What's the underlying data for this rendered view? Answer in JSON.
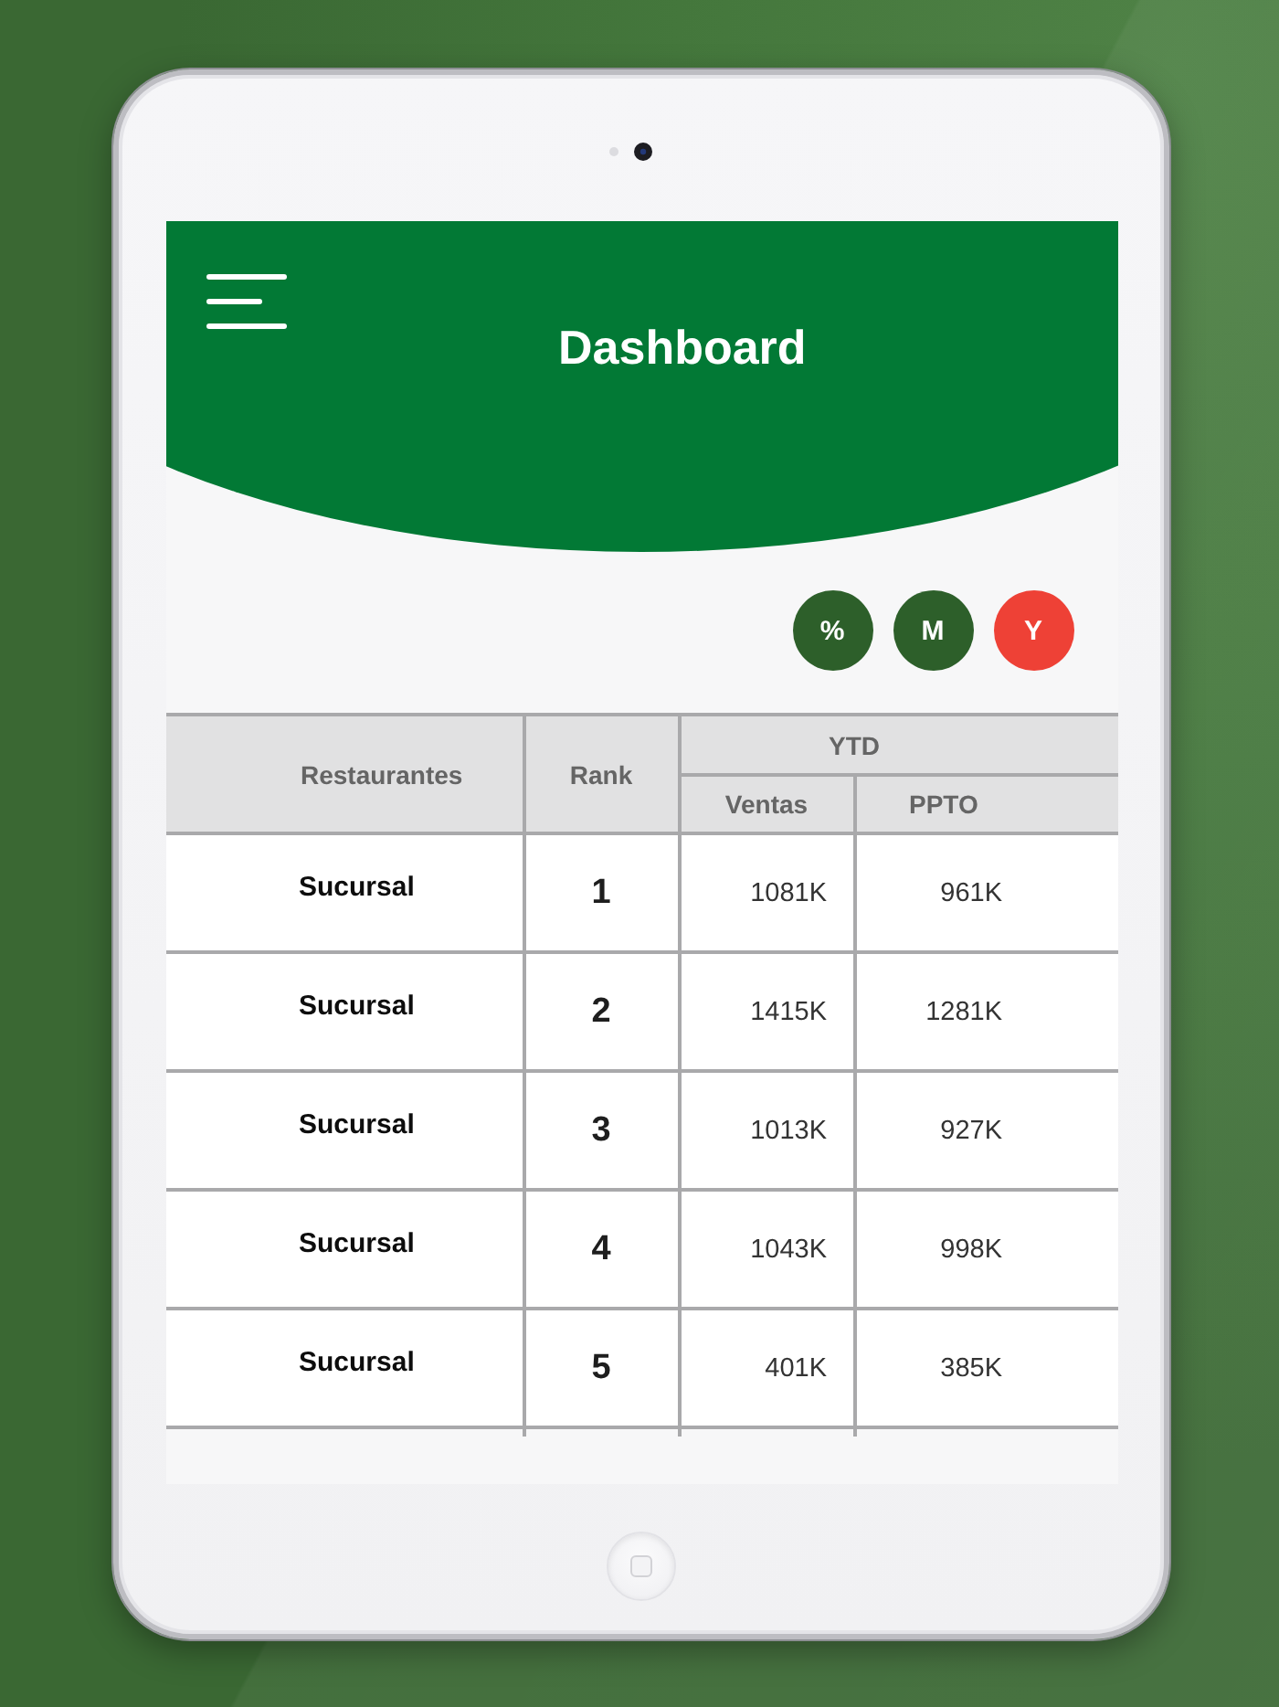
{
  "header": {
    "title": "Dashboard"
  },
  "period_buttons": [
    {
      "label": "%",
      "selected": false
    },
    {
      "label": "M",
      "selected": false
    },
    {
      "label": "Y",
      "selected": true
    }
  ],
  "table": {
    "columns": [
      {
        "label": "Restaurantes"
      },
      {
        "label": "Rank"
      },
      {
        "label": "YTD",
        "children": [
          {
            "label": "Ventas"
          },
          {
            "label": "PPTO"
          }
        ]
      }
    ],
    "rows": [
      {
        "restaurant": "Sucursal",
        "rank": "1",
        "ventas": "1081K",
        "ppto": "961K"
      },
      {
        "restaurant": "Sucursal",
        "rank": "2",
        "ventas": "1415K",
        "ppto": "1281K"
      },
      {
        "restaurant": "Sucursal",
        "rank": "3",
        "ventas": "1013K",
        "ppto": "927K"
      },
      {
        "restaurant": "Sucursal",
        "rank": "4",
        "ventas": "1043K",
        "ppto": "998K"
      },
      {
        "restaurant": "Sucursal",
        "rank": "5",
        "ventas": "401K",
        "ppto": "385K"
      }
    ]
  }
}
